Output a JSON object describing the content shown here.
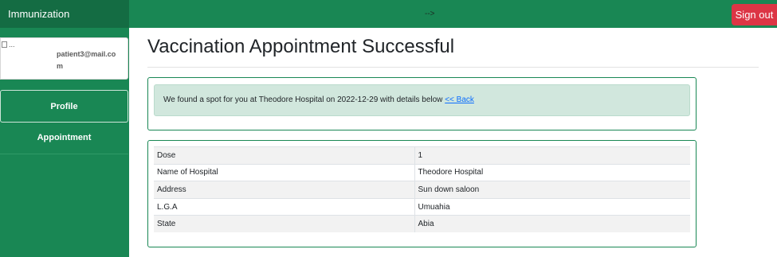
{
  "header": {
    "brand": "Immunization",
    "mid_text": "-->",
    "sign_out": "Sign out"
  },
  "sidebar": {
    "avatar_alt": "...",
    "email": "patient3@mail.com",
    "items": [
      {
        "label": "Profile"
      },
      {
        "label": "Appointment"
      }
    ]
  },
  "main": {
    "title": "Vaccination Appointment Successful",
    "alert": {
      "message": "We found a spot for you at Theodore Hospital on 2022-12-29 with details below",
      "back_link": "<< Back"
    },
    "details": [
      {
        "label": "Dose",
        "value": "1"
      },
      {
        "label": "Name of Hospital",
        "value": "Theodore Hospital"
      },
      {
        "label": "Address",
        "value": "Sun down saloon"
      },
      {
        "label": "L.G.A",
        "value": "Umuahia"
      },
      {
        "label": "State",
        "value": "Abia"
      }
    ]
  },
  "colors": {
    "primary": "#198754",
    "brand_dark": "#146c43",
    "danger": "#dc3545",
    "alert_bg": "#d1e7dd",
    "link": "#0d6efd"
  }
}
